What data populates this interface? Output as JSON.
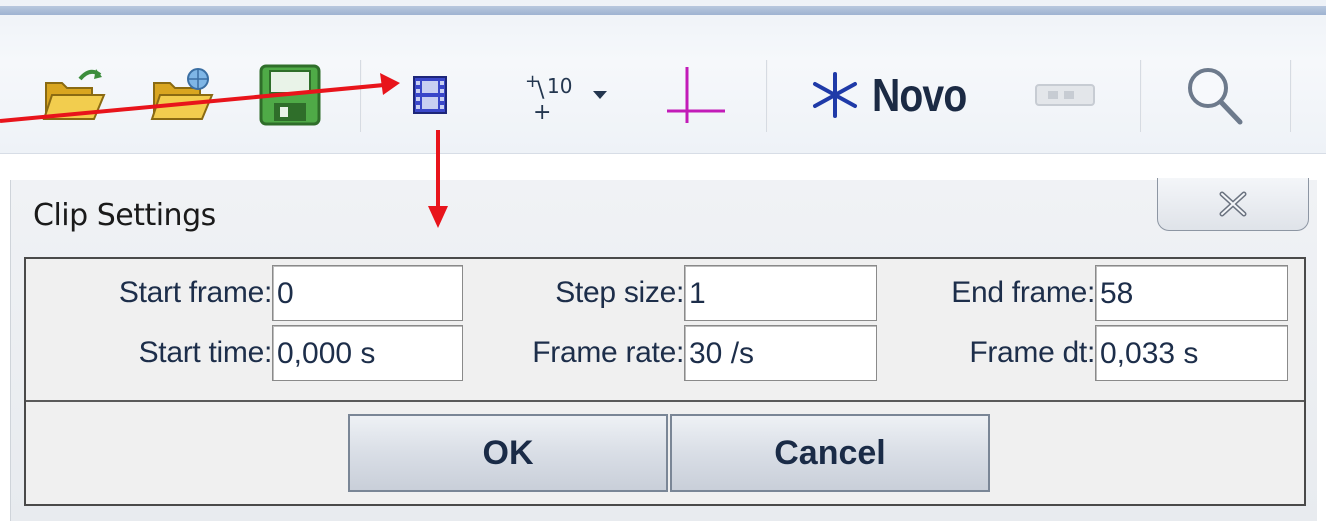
{
  "toolbar": {
    "buttons": [
      {
        "icon": "open-folder-icon"
      },
      {
        "icon": "open-folder-web-icon"
      },
      {
        "icon": "save-disk-icon"
      },
      {
        "icon": "clip-settings-film-icon"
      },
      {
        "icon": "step-icon"
      },
      {
        "icon": "coordinate-axes-icon"
      },
      {
        "icon": "new-track-star-icon"
      },
      {
        "icon": "tape-measure-icon"
      },
      {
        "icon": "zoom-magnifier-icon"
      }
    ],
    "new_label": "Novo",
    "colors": {
      "accent_blue": "#3a47c9",
      "magenta_axes": "#c21bb8",
      "save_green": "#3e9a3a"
    }
  },
  "dialog": {
    "title": "Clip Settings",
    "close_icon": "close-x-icon",
    "fields": [
      {
        "label": "Start frame:",
        "value": "0"
      },
      {
        "label": "Step size:",
        "value": "1"
      },
      {
        "label": "End frame:",
        "value": "58"
      },
      {
        "label": "Start time:",
        "value": "0,000 s"
      },
      {
        "label": "Frame rate:",
        "value": "30 /s"
      },
      {
        "label": "Frame dt:",
        "value": "0,033 s"
      }
    ],
    "ok_label": "OK",
    "cancel_label": "Cancel"
  },
  "annotation": {
    "arrow_color": "#e8141b"
  }
}
